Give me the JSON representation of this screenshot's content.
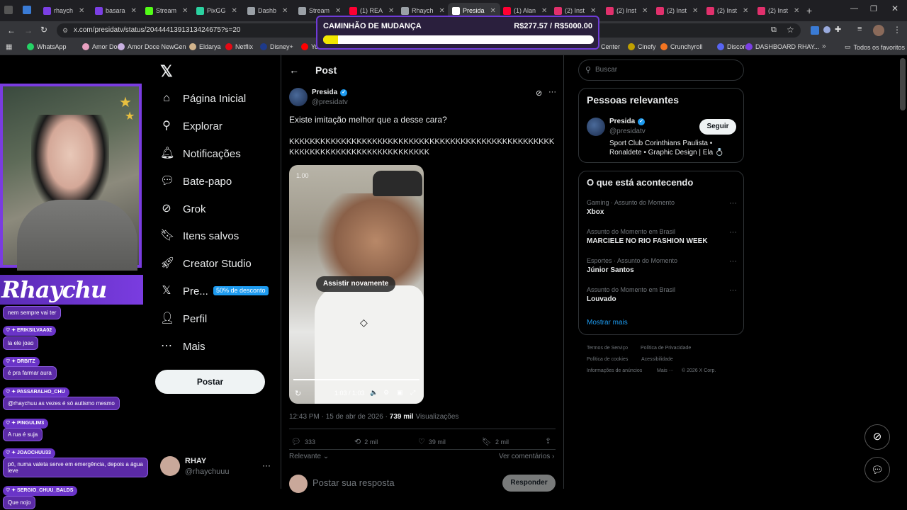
{
  "browser": {
    "tabs": [
      {
        "label": "rhaych",
        "color": "#7b3fe4"
      },
      {
        "label": "basara",
        "color": "#7b3fe4"
      },
      {
        "label": "Stream",
        "color": "#53fc18"
      },
      {
        "label": "PixGG",
        "color": "#2bd1a0"
      },
      {
        "label": "Dashb",
        "color": "#9aa0a6"
      },
      {
        "label": "Stream",
        "color": "#9aa0a6"
      },
      {
        "label": "(1) REA",
        "color": "#ff0033"
      },
      {
        "label": "Rhaych",
        "color": "#9aa0a6"
      },
      {
        "label": "Presida",
        "color": "#ffffff"
      },
      {
        "label": "(1) Alan",
        "color": "#ff0033"
      },
      {
        "label": "(2) Inst",
        "color": "#e1306c"
      },
      {
        "label": "(2) Inst",
        "color": "#e1306c"
      },
      {
        "label": "(2) Inst",
        "color": "#e1306c"
      },
      {
        "label": "(2) Inst",
        "color": "#e1306c"
      },
      {
        "label": "(2) Inst",
        "color": "#e1306c"
      }
    ],
    "url": "x.com/presidatv/status/2044441391313424675?s=20",
    "bookmarks_left": [
      {
        "label": "WhatsApp",
        "color": "#25d366"
      },
      {
        "label": "Amor Doce",
        "color": "#e8a0c0"
      },
      {
        "label": "Amor Doce NewGen",
        "color": "#c8b0e0"
      },
      {
        "label": "Eldarya",
        "color": "#d2b48c"
      },
      {
        "label": "Netflix",
        "color": "#e50914"
      },
      {
        "label": "Disney+",
        "color": "#1e3a8a"
      },
      {
        "label": "Yo",
        "color": "#ff0000"
      }
    ],
    "bookmarks_right": [
      {
        "label": "Center",
        "color": "#666666"
      },
      {
        "label": "Cinefy",
        "color": "#c0a000"
      },
      {
        "label": "Crunchyroll",
        "color": "#f47521"
      },
      {
        "label": "Discord",
        "color": "#5865f2"
      },
      {
        "label": "DASHBOARD RHAY...",
        "color": "#7b3fe4"
      }
    ],
    "all_bookmarks": "Todos os favoritos"
  },
  "goal": {
    "title": "CAMINHÃO DE MUDANÇA",
    "amount": "R$277.57 / R$5000.00",
    "progress": 0.0555
  },
  "overlay": {
    "logo": "Rhaychu",
    "chat": [
      {
        "name": "",
        "msg": "nem sempre vai ter"
      },
      {
        "name": "ERIKSILVAA02",
        "msg": "la ele joao"
      },
      {
        "name": "DRBITZ",
        "msg": "é pra farmar aura"
      },
      {
        "name": "PASSARALHO_CHU",
        "msg": "@rhaychuu as vezes é só autismo mesmo"
      },
      {
        "name": "PINGULIM3",
        "msg": "A rua é suja"
      },
      {
        "name": "JOAOCHUU33",
        "msg": "pô, numa valeta serve em emergência, depois a água leve"
      },
      {
        "name": "SERGIO_CHUU_BALDS",
        "msg": "Que nojo"
      }
    ]
  },
  "nav": {
    "items": [
      {
        "label": "Página Inicial",
        "icon": "home-icon"
      },
      {
        "label": "Explorar",
        "icon": "search-icon"
      },
      {
        "label": "Notificações",
        "icon": "bell-icon"
      },
      {
        "label": "Bate-papo",
        "icon": "chat-icon"
      },
      {
        "label": "Grok",
        "icon": "grok-icon"
      },
      {
        "label": "Itens salvos",
        "icon": "bookmark-icon"
      },
      {
        "label": "Creator Studio",
        "icon": "rocket-icon"
      },
      {
        "label": "Pre...",
        "icon": "x-logo-icon"
      },
      {
        "label": "Perfil",
        "icon": "person-icon"
      },
      {
        "label": "Mais",
        "icon": "more-icon"
      }
    ],
    "premium_badge": "50% de desconto",
    "post_button": "Postar",
    "account_name": "RHAY",
    "account_handle": "@rhaychuuu"
  },
  "post": {
    "header": "Post",
    "author_name": "Presida",
    "author_handle": "@presidatv",
    "text_line1": "Existe imitação melhor que a desse cara?",
    "text_line2": "KKKKKKKKKKKKKKKKKKKKKKKKKKKKKKKKKKKKKKKKKKKKKKKKKKKKKKKKKKKKKKKKKKKKKKKKKKKKKK",
    "video_speed": "1.00",
    "replay_label": "Assistir novamente",
    "video_time": "1:03 / 1:03",
    "timestamp": "12:43 PM · 15 de abr de 2026 · ",
    "views_count": "739 mil",
    "views_label": " Visualizações",
    "replies": "333",
    "reposts": "2 mil",
    "likes": "39 mil",
    "bookmarks": "2 mil",
    "sort_label": "Relevante",
    "see_comments": "Ver comentários",
    "reply_placeholder": "Postar sua resposta",
    "reply_button": "Responder"
  },
  "sidebar": {
    "search_placeholder": "Buscar",
    "relevant_title": "Pessoas relevantes",
    "person_name": "Presida",
    "person_handle": "@presidatv",
    "person_bio": "Sport Club Corinthians Paulista • Ronaldete • Graphic Design | Ela 💍",
    "follow_label": "Seguir",
    "trending_title": "O que está acontecendo",
    "trends": [
      {
        "context": "Gaming · Assunto do Momento",
        "topic": "Xbox"
      },
      {
        "context": "Assunto do Momento em Brasil",
        "topic": "MARCIELE NO RIO FASHION WEEK"
      },
      {
        "context": "Esportes · Assunto do Momento",
        "topic": "Júnior Santos"
      },
      {
        "context": "Assunto do Momento em Brasil",
        "topic": "Louvado"
      }
    ],
    "show_more": "Mostrar mais",
    "footer": [
      "Termos de Serviço",
      "Política de Privacidade",
      "Política de cookies",
      "Acessibilidade",
      "Informações de anúncios",
      "Mais ···",
      "© 2026 X Corp."
    ]
  }
}
